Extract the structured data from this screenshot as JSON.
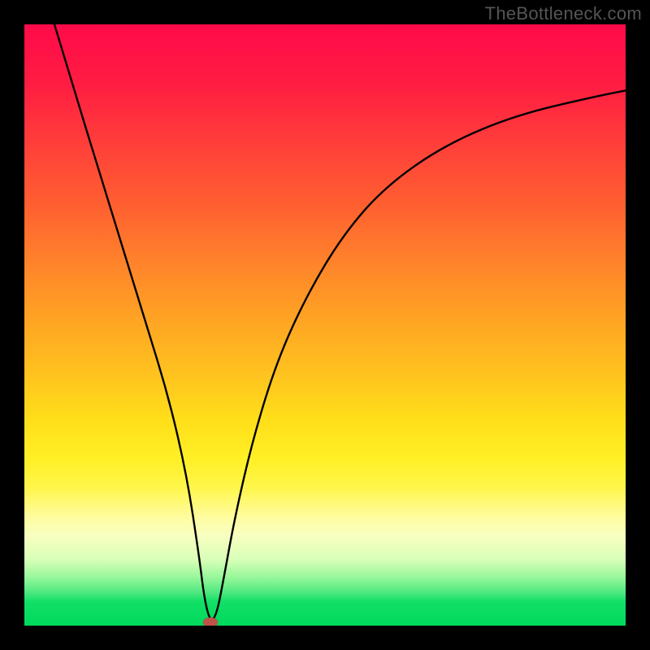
{
  "watermark": "TheBottleneck.com",
  "chart_data": {
    "type": "line",
    "title": "",
    "xlabel": "",
    "ylabel": "",
    "xlim": [
      0,
      100
    ],
    "ylim": [
      0,
      100
    ],
    "grid": false,
    "legend": false,
    "series": [
      {
        "name": "bottleneck-curve",
        "x": [
          5,
          8,
          12,
          16,
          20,
          24,
          27,
          29,
          30,
          31,
          32,
          33,
          35,
          38,
          42,
          47,
          53,
          60,
          70,
          82,
          95,
          100
        ],
        "y": [
          100,
          90,
          77,
          64,
          51,
          38,
          25,
          12,
          4,
          0.5,
          2,
          7,
          18,
          31,
          44,
          55,
          65,
          73,
          80,
          85,
          88,
          89
        ]
      }
    ],
    "marker": {
      "name": "optimal-point",
      "x": 31,
      "y": 0.5,
      "color": "#c0524a"
    },
    "background": {
      "type": "vertical-gradient",
      "stops": [
        {
          "pos": 0,
          "color": "#ff0a4a"
        },
        {
          "pos": 40,
          "color": "#ff8a28"
        },
        {
          "pos": 70,
          "color": "#ffef24"
        },
        {
          "pos": 85,
          "color": "#fffca0"
        },
        {
          "pos": 92,
          "color": "#96f79a"
        },
        {
          "pos": 100,
          "color": "#00da5c"
        }
      ]
    }
  }
}
